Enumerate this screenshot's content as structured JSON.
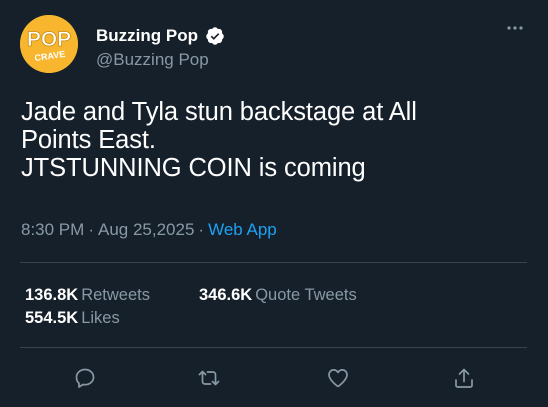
{
  "account": {
    "avatar_text_top": "POP",
    "avatar_text_bottom": "CRAVE",
    "display_name": "Buzzing Pop",
    "handle": "@Buzzing Pop",
    "verified": true
  },
  "tweet": {
    "lines": [
      "Jade and Tyla stun backstage at All",
      "Points East.",
      "JTSTUNNING COIN is coming"
    ],
    "time": "8:30 PM",
    "date": "Aug 25,2025",
    "source": "Web App",
    "separator": "·"
  },
  "stats": {
    "retweets_count": "136.8K",
    "retweets_label": "Retweets",
    "quotes_count": "346.6K",
    "quotes_label": "Quote Tweets",
    "likes_count": "554.5K",
    "likes_label": "Likes"
  },
  "icons": {
    "more": "more-horizontal-icon",
    "reply": "reply-icon",
    "retweet": "retweet-icon",
    "like": "heart-icon",
    "share": "share-icon",
    "verified": "verified-badge-icon"
  },
  "colors": {
    "background": "#15202b",
    "text_primary": "#ffffff",
    "text_secondary": "#8899a6",
    "link": "#1da1f2",
    "divider": "#38444d",
    "avatar_bg": "#f7b62e",
    "avatar_text": "#ffffff"
  }
}
